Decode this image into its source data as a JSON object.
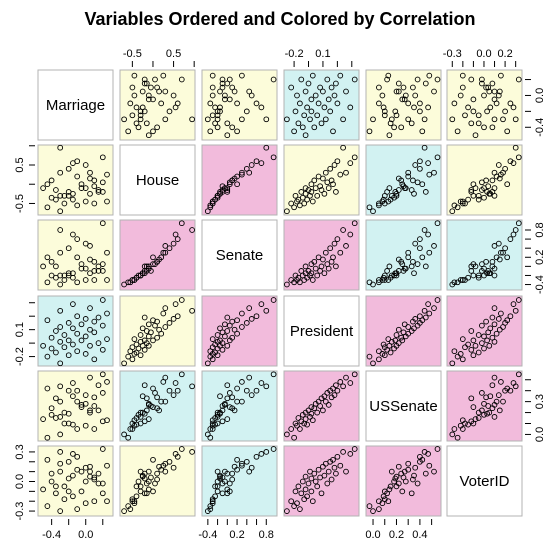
{
  "chart_data": {
    "type": "scatter-matrix",
    "title": "Variables Ordered and Colored by Correlation",
    "color_key": {
      "Y": "#FCFCDA",
      "C": "#D2F2F2",
      "P": "#F2BBDC"
    },
    "panel_colors": [
      [
        "-",
        "Y",
        "Y",
        "C",
        "Y",
        "Y"
      ],
      [
        "Y",
        "-",
        "P",
        "Y",
        "C",
        "Y"
      ],
      [
        "Y",
        "P",
        "-",
        "P",
        "C",
        "C"
      ],
      [
        "C",
        "Y",
        "P",
        "-",
        "P",
        "P"
      ],
      [
        "Y",
        "C",
        "C",
        "P",
        "-",
        "P"
      ],
      [
        "Y",
        "Y",
        "C",
        "P",
        "P",
        "-"
      ]
    ],
    "variables": [
      {
        "name": "Marriage",
        "range": [
          -0.56,
          0.32
        ],
        "ticks": [
          -0.4,
          -0.2,
          0.0,
          0.2
        ],
        "tick_labels": [
          "-0.4",
          "",
          "0.0",
          ""
        ],
        "values": [
          -0.3,
          0.1,
          -0.45,
          -0.2,
          0.0,
          -0.35,
          -0.1,
          0.2,
          -0.4,
          -0.25,
          0.05,
          -0.5,
          -0.15,
          0.15,
          -0.3,
          -0.05,
          -0.2,
          0.25,
          -0.4,
          0.0,
          -0.25,
          -0.1,
          0.1,
          -0.35,
          0.05,
          -0.15,
          -0.3,
          0.2,
          -0.05,
          -0.2,
          0.1,
          -0.45,
          0.0,
          0.15,
          -0.1,
          0.25,
          -0.3,
          0.05,
          -0.15,
          0.2
        ]
      },
      {
        "name": "House",
        "range": [
          -0.8,
          1.02
        ],
        "ticks": [
          -0.5,
          0.0,
          0.5,
          1.0
        ],
        "tick_labels": [
          "-0.5",
          "",
          "0.5",
          ""
        ],
        "values": [
          -0.7,
          -0.5,
          -0.6,
          -0.3,
          -0.45,
          -0.4,
          -0.55,
          -0.2,
          -0.35,
          -0.5,
          -0.25,
          -0.1,
          -0.4,
          -0.15,
          -0.3,
          0.0,
          -0.2,
          -0.45,
          0.1,
          -0.1,
          -0.3,
          0.2,
          -0.05,
          -0.15,
          0.15,
          -0.25,
          0.3,
          0.05,
          -0.1,
          0.4,
          0.1,
          0.0,
          0.5,
          -0.2,
          0.6,
          0.25,
          0.95,
          0.3,
          0.55,
          0.7
        ]
      },
      {
        "name": "Senate",
        "range": [
          -0.52,
          1.02
        ],
        "ticks": [
          -0.4,
          -0.2,
          0.0,
          0.2,
          0.4,
          0.6,
          0.8
        ],
        "tick_labels": [
          "-0.4",
          "",
          "",
          "0.2",
          "",
          "",
          "0.8"
        ],
        "values": [
          -0.4,
          -0.3,
          -0.35,
          -0.2,
          -0.3,
          -0.25,
          -0.35,
          -0.1,
          -0.2,
          -0.3,
          -0.15,
          0.0,
          -0.25,
          -0.1,
          -0.2,
          0.05,
          -0.15,
          -0.3,
          0.1,
          -0.05,
          -0.2,
          0.2,
          -0.1,
          0.0,
          0.15,
          -0.15,
          0.3,
          0.05,
          -0.05,
          0.4,
          0.1,
          0.2,
          0.5,
          0.0,
          0.6,
          0.3,
          0.8,
          0.45,
          0.7,
          0.95
        ]
      },
      {
        "name": "President",
        "range": [
          -0.27,
          0.25
        ],
        "ticks": [
          -0.2,
          -0.1,
          0.0,
          0.1,
          0.2
        ],
        "tick_labels": [
          "-0.2",
          "",
          "0.1",
          "",
          ""
        ],
        "values": [
          -0.25,
          -0.22,
          -0.2,
          -0.19,
          -0.18,
          -0.17,
          -0.16,
          -0.15,
          -0.14,
          -0.13,
          -0.12,
          -0.12,
          -0.11,
          -0.1,
          -0.09,
          -0.08,
          -0.08,
          -0.07,
          -0.06,
          -0.05,
          -0.04,
          -0.03,
          -0.02,
          -0.01,
          0.0,
          0.01,
          0.02,
          0.03,
          0.04,
          0.05,
          0.06,
          0.07,
          0.08,
          0.09,
          0.1,
          0.12,
          0.14,
          0.16,
          0.19,
          0.22
        ]
      },
      {
        "name": "USSenate",
        "range": [
          -0.06,
          0.58
        ],
        "ticks": [
          0.0,
          0.1,
          0.2,
          0.3,
          0.4,
          0.5
        ],
        "tick_labels": [
          "0.0",
          "",
          "0.2",
          "",
          "0.4",
          ""
        ],
        "right_tick_labels": [
          "0.0",
          "",
          "",
          "0.3",
          "",
          ""
        ],
        "values": [
          0.0,
          0.05,
          -0.03,
          0.1,
          0.08,
          0.15,
          0.05,
          0.12,
          0.18,
          0.1,
          0.2,
          0.14,
          0.09,
          0.22,
          0.16,
          0.25,
          0.19,
          0.13,
          0.24,
          0.28,
          0.2,
          0.3,
          0.26,
          0.33,
          0.22,
          0.35,
          0.3,
          0.38,
          0.27,
          0.4,
          0.34,
          0.42,
          0.36,
          0.45,
          0.4,
          0.48,
          0.44,
          0.52,
          0.47,
          0.55
        ]
      },
      {
        "name": "VoterID",
        "range": [
          -0.35,
          0.36
        ],
        "ticks": [
          -0.3,
          -0.2,
          -0.1,
          0.0,
          0.1,
          0.2,
          0.3
        ],
        "tick_labels": [
          "-0.3",
          "",
          "",
          "0.0",
          "",
          "0.2",
          ""
        ],
        "left_tick_labels": [
          "-0.3",
          "",
          "",
          "0.0",
          "",
          "",
          "0.3"
        ],
        "values": [
          -0.3,
          -0.2,
          -0.25,
          -0.1,
          -0.22,
          -0.05,
          -0.28,
          -0.12,
          0.0,
          -0.18,
          0.05,
          -0.08,
          -0.15,
          -0.02,
          0.1,
          -0.1,
          0.03,
          -0.2,
          0.08,
          0.0,
          -0.05,
          0.12,
          0.04,
          -0.12,
          0.15,
          0.06,
          0.18,
          -0.02,
          0.1,
          0.2,
          0.02,
          0.22,
          0.14,
          0.08,
          0.25,
          0.16,
          0.3,
          0.1,
          0.28,
          0.33
        ]
      }
    ]
  }
}
